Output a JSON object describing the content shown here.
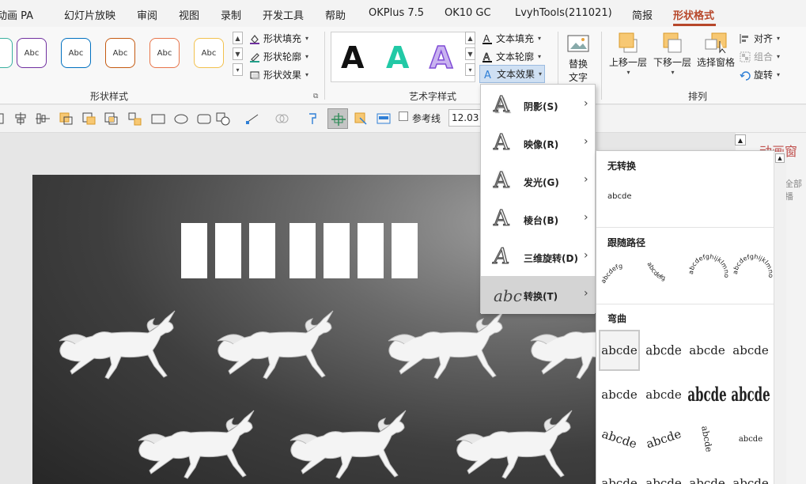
{
  "tabs": [
    {
      "id": "anim",
      "label": "动画 PA"
    },
    {
      "id": "slideshow",
      "label": "幻灯片放映"
    },
    {
      "id": "review",
      "label": "审阅"
    },
    {
      "id": "view",
      "label": "视图"
    },
    {
      "id": "record",
      "label": "录制"
    },
    {
      "id": "dev",
      "label": "开发工具"
    },
    {
      "id": "help",
      "label": "帮助"
    },
    {
      "id": "okplus",
      "label": "OKPlus 7.5"
    },
    {
      "id": "ok10",
      "label": "OK10 GC"
    },
    {
      "id": "lvyh",
      "label": "LvyhTools(211021)"
    },
    {
      "id": "simple",
      "label": "简报"
    },
    {
      "id": "shapefmt",
      "label": "形状格式"
    }
  ],
  "ribbon": {
    "shape_styles": {
      "swatch_text": "Abc",
      "swatch_colors": [
        "#7030a0",
        "#0070c0",
        "#c55a11",
        "#e8754a",
        "#f2c14e"
      ],
      "fill": "形状填充",
      "outline": "形状轮廓",
      "effects": "形状效果",
      "label": "形状样式"
    },
    "wordart": {
      "letter": "A",
      "colors": [
        "#111111",
        "#22c9a6",
        "#7f4bd6"
      ],
      "text_fill": "文本填充",
      "text_outline": "文本轮廓",
      "text_effects": "文本效果",
      "label": "艺术字样式"
    },
    "alt_text": {
      "line1": "替换",
      "line2": "文字"
    },
    "arrange": {
      "bring_forward": "上移一层",
      "send_backward": "下移一层",
      "selection_pane": "选择窗格",
      "align": "对齐",
      "group": "组合",
      "rotate": "旋转",
      "label": "排列"
    }
  },
  "toolbar": {
    "guides_label": "参考线",
    "size_value": "12.03"
  },
  "text_effects_menu": [
    {
      "id": "shadow",
      "label": "阴影(S)",
      "icon": "shadow-A-icon"
    },
    {
      "id": "reflection",
      "label": "映像(R)",
      "icon": "reflection-A-icon"
    },
    {
      "id": "glow",
      "label": "发光(G)",
      "icon": "glow-A-icon"
    },
    {
      "id": "bevel",
      "label": "棱台(B)",
      "icon": "bevel-A-icon"
    },
    {
      "id": "rotation3d",
      "label": "三维旋转(D)",
      "icon": "3d-rotation-A-icon"
    },
    {
      "id": "transform",
      "label": "转换(T)",
      "icon": "transform-abc-icon",
      "glyph": "abc"
    }
  ],
  "transform_submenu": {
    "no_transform_header": "无转换",
    "no_transform_sample": "abcde",
    "follow_path_header": "跟随路径",
    "follow_path_samples": [
      "abcdefg",
      "abcdefg",
      "abcdefghijklmno",
      "abcdefghijklmno"
    ],
    "warp_header": "弯曲",
    "warp_sample": "abcde"
  },
  "anim_pane": {
    "title": "动画窗",
    "subtitle": "全部播"
  },
  "colors": {
    "accent": "#b7472a",
    "menu_selected": "#d4d4d4"
  }
}
